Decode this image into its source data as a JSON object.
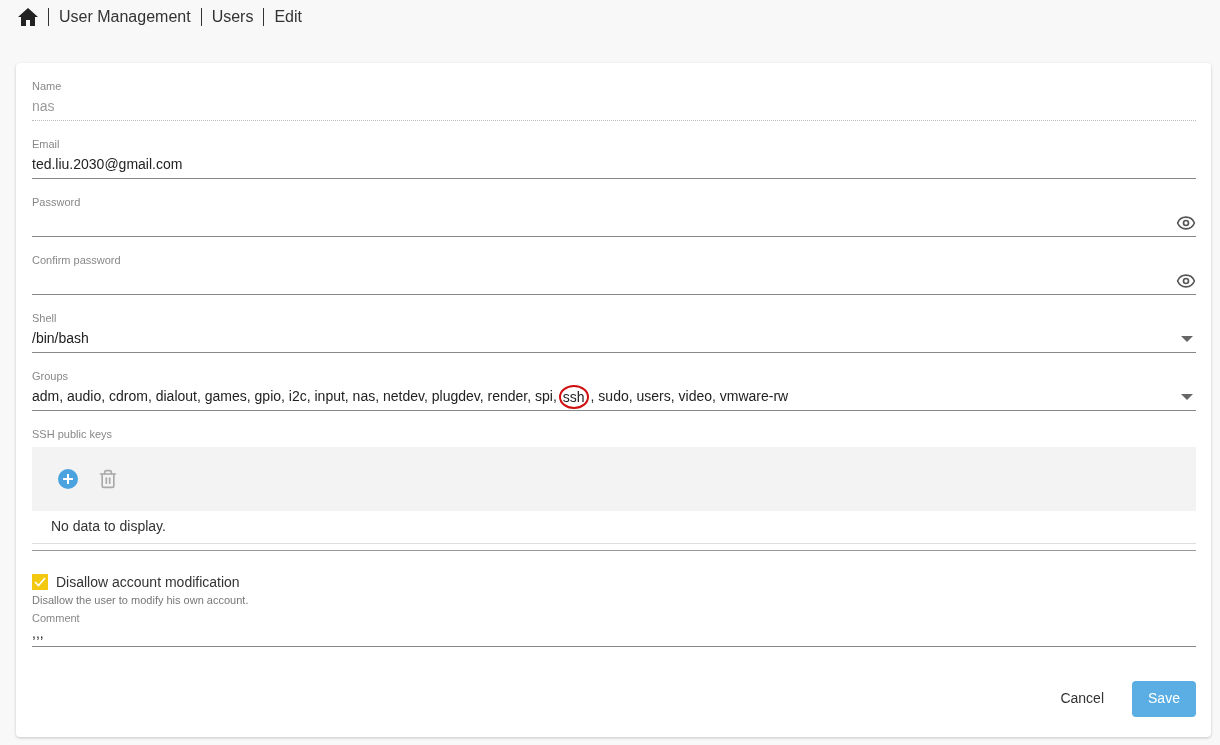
{
  "breadcrumb": [
    "User Management",
    "Users",
    "Edit"
  ],
  "fields": [
    {
      "kind": "text",
      "label": "Name",
      "value": "nas",
      "disabled": true
    },
    {
      "kind": "text",
      "label": "Email",
      "value": "ted.liu.2030@gmail.com",
      "disabled": false
    },
    {
      "kind": "password",
      "label": "Password",
      "disabled": false
    },
    {
      "kind": "password",
      "label": "Confirm password",
      "disabled": false
    },
    {
      "kind": "select",
      "label": "Shell",
      "value": "/bin/bash",
      "disabled": false
    },
    {
      "kind": "select",
      "label": "Groups",
      "value": "adm, audio, cdrom, dialout, games, gpio, i2c, input, nas, netdev, plugdev, render, spi,",
      "circled_value": "ssh",
      "value_after": ", sudo, users, video, vmware-rw",
      "disabled": false
    }
  ],
  "ssh_keys": {
    "label": "SSH public keys",
    "empty_text": "No data to display."
  },
  "disallow": {
    "label": "Disallow account modification",
    "hint": "Disallow the user to modify his own account.",
    "checked": true
  },
  "comment": {
    "label": "Comment",
    "value": ",,,"
  },
  "buttons": {
    "cancel": "Cancel",
    "save": "Save"
  }
}
